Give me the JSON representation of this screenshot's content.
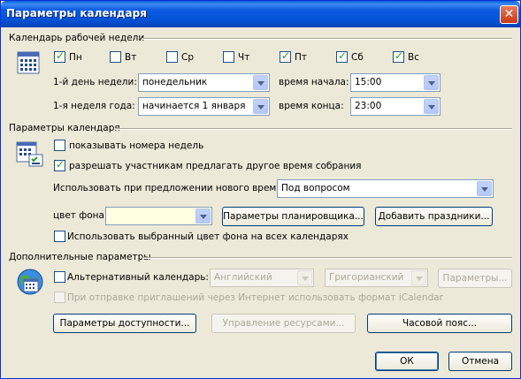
{
  "window": {
    "title": "Параметры календаря",
    "close_label": "✕"
  },
  "work_week": {
    "section_title": "Календарь рабочей недели",
    "days": [
      {
        "label": "Пн",
        "checked": true
      },
      {
        "label": "Вт",
        "checked": false
      },
      {
        "label": "Ср",
        "checked": false
      },
      {
        "label": "Чт",
        "checked": false
      },
      {
        "label": "Пт",
        "checked": true
      },
      {
        "label": "Сб",
        "checked": true
      },
      {
        "label": "Вс",
        "checked": true
      }
    ],
    "first_day_label": "1-й день недели:",
    "first_day_value": "понедельник",
    "first_week_label": "1-я неделя года:",
    "first_week_value": "начинается 1 января",
    "start_time_label": "время начала:",
    "start_time_value": "15:00",
    "end_time_label": "время конца:",
    "end_time_value": "23:00"
  },
  "calendar_options": {
    "section_title": "Параметры календаря",
    "show_week_numbers_label": "показывать номера недель",
    "show_week_numbers": false,
    "allow_propose_label": "разрешать участникам предлагать другое время собрания",
    "allow_propose": true,
    "use_when_propose_label": "Использовать при предложении нового времени:",
    "use_when_propose_value": "Под вопросом",
    "bg_color_label": "цвет фона:",
    "bg_color_value": "#ffffe1",
    "scheduler_button": "Параметры планировщика...",
    "add_holidays_button": "Добавить праздники...",
    "use_bg_all_label": "Использовать выбранный цвет фона на всех календарях",
    "use_bg_all": false
  },
  "advanced": {
    "section_title": "Дополнительные параметры",
    "alt_calendar_label": "Альтернативный календарь:",
    "alt_calendar": false,
    "language_value": "Английский",
    "calendar_type_value": "Григорианский",
    "params_button": "Параметры...",
    "icalendar_label": "При отправке приглашений через Интернет использовать формат iCalendar",
    "availability_button": "Параметры доступности...",
    "resources_button": "Управление ресурсами...",
    "timezone_button": "Часовой пояс..."
  },
  "footer": {
    "ok_button": "ОК",
    "cancel_button": "Отмена"
  }
}
